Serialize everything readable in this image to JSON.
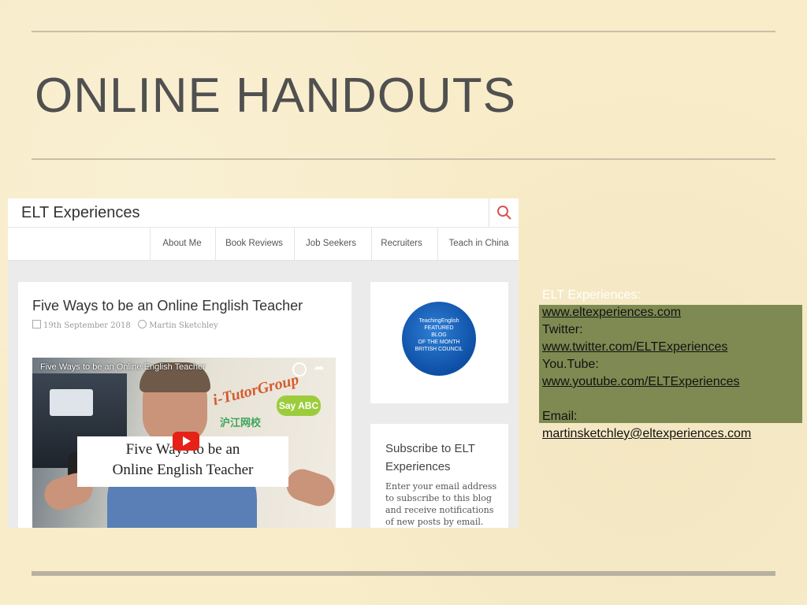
{
  "slide": {
    "title": "ONLINE HANDOUTS"
  },
  "blog": {
    "site_name": "ELT Experiences",
    "nav": [
      "About Me",
      "Book Reviews",
      "Job Seekers",
      "Recruiters",
      "Teach in China"
    ],
    "post": {
      "title": "Five Ways to be an Online English Teacher",
      "date": "19th September 2018",
      "author": "Martin Sketchley"
    },
    "video": {
      "top_title": "Five Ways to be an Online English Teacher",
      "caption_line1": "Five Ways to be an",
      "caption_line2": "Online English Teacher",
      "brand": "i-TutorGroup",
      "brand2": "Say ABC",
      "cn_brand": "沪江网校"
    },
    "badge": {
      "line1": "TeachingEnglish",
      "line2": "FEATURED",
      "line3": "BLOG",
      "line4": "OF THE MONTH",
      "line5": "BRITISH COUNCIL"
    },
    "subscribe": {
      "title": "Subscribe to ELT Experiences",
      "text": "Enter your email address to subscribe to this blog and receive notifications of new posts by email."
    }
  },
  "contacts": {
    "elt_label": "ELT Experiences:",
    "elt_url": "www.eltexperiences.com",
    "twitter_label": "Twitter:",
    "twitter_url": "www.twitter.com/ELTExperiences",
    "youtube_label": "You.Tube:",
    "youtube_url": "www.youtube.com/ELTExperiences",
    "email_label": "Email:",
    "email": "martinsketchley@eltexperiences.com"
  },
  "colors": {
    "background": "#f8ecc9",
    "highlight": "#7e8a52",
    "title": "#505050"
  }
}
